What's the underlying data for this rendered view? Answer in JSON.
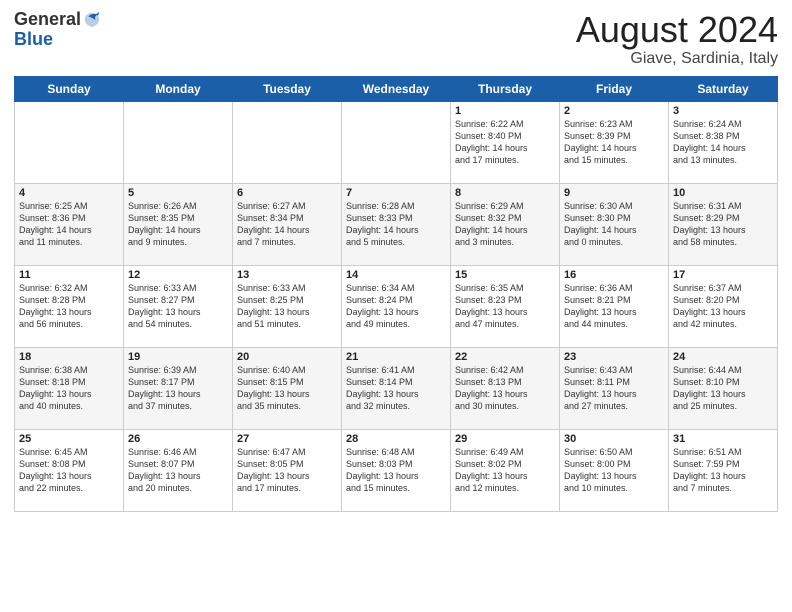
{
  "header": {
    "logo_line1": "General",
    "logo_line2": "Blue",
    "month_title": "August 2024",
    "location": "Giave, Sardinia, Italy"
  },
  "days_of_week": [
    "Sunday",
    "Monday",
    "Tuesday",
    "Wednesday",
    "Thursday",
    "Friday",
    "Saturday"
  ],
  "weeks": [
    [
      {
        "day": "",
        "info": ""
      },
      {
        "day": "",
        "info": ""
      },
      {
        "day": "",
        "info": ""
      },
      {
        "day": "",
        "info": ""
      },
      {
        "day": "1",
        "info": "Sunrise: 6:22 AM\nSunset: 8:40 PM\nDaylight: 14 hours\nand 17 minutes."
      },
      {
        "day": "2",
        "info": "Sunrise: 6:23 AM\nSunset: 8:39 PM\nDaylight: 14 hours\nand 15 minutes."
      },
      {
        "day": "3",
        "info": "Sunrise: 6:24 AM\nSunset: 8:38 PM\nDaylight: 14 hours\nand 13 minutes."
      }
    ],
    [
      {
        "day": "4",
        "info": "Sunrise: 6:25 AM\nSunset: 8:36 PM\nDaylight: 14 hours\nand 11 minutes."
      },
      {
        "day": "5",
        "info": "Sunrise: 6:26 AM\nSunset: 8:35 PM\nDaylight: 14 hours\nand 9 minutes."
      },
      {
        "day": "6",
        "info": "Sunrise: 6:27 AM\nSunset: 8:34 PM\nDaylight: 14 hours\nand 7 minutes."
      },
      {
        "day": "7",
        "info": "Sunrise: 6:28 AM\nSunset: 8:33 PM\nDaylight: 14 hours\nand 5 minutes."
      },
      {
        "day": "8",
        "info": "Sunrise: 6:29 AM\nSunset: 8:32 PM\nDaylight: 14 hours\nand 3 minutes."
      },
      {
        "day": "9",
        "info": "Sunrise: 6:30 AM\nSunset: 8:30 PM\nDaylight: 14 hours\nand 0 minutes."
      },
      {
        "day": "10",
        "info": "Sunrise: 6:31 AM\nSunset: 8:29 PM\nDaylight: 13 hours\nand 58 minutes."
      }
    ],
    [
      {
        "day": "11",
        "info": "Sunrise: 6:32 AM\nSunset: 8:28 PM\nDaylight: 13 hours\nand 56 minutes."
      },
      {
        "day": "12",
        "info": "Sunrise: 6:33 AM\nSunset: 8:27 PM\nDaylight: 13 hours\nand 54 minutes."
      },
      {
        "day": "13",
        "info": "Sunrise: 6:33 AM\nSunset: 8:25 PM\nDaylight: 13 hours\nand 51 minutes."
      },
      {
        "day": "14",
        "info": "Sunrise: 6:34 AM\nSunset: 8:24 PM\nDaylight: 13 hours\nand 49 minutes."
      },
      {
        "day": "15",
        "info": "Sunrise: 6:35 AM\nSunset: 8:23 PM\nDaylight: 13 hours\nand 47 minutes."
      },
      {
        "day": "16",
        "info": "Sunrise: 6:36 AM\nSunset: 8:21 PM\nDaylight: 13 hours\nand 44 minutes."
      },
      {
        "day": "17",
        "info": "Sunrise: 6:37 AM\nSunset: 8:20 PM\nDaylight: 13 hours\nand 42 minutes."
      }
    ],
    [
      {
        "day": "18",
        "info": "Sunrise: 6:38 AM\nSunset: 8:18 PM\nDaylight: 13 hours\nand 40 minutes."
      },
      {
        "day": "19",
        "info": "Sunrise: 6:39 AM\nSunset: 8:17 PM\nDaylight: 13 hours\nand 37 minutes."
      },
      {
        "day": "20",
        "info": "Sunrise: 6:40 AM\nSunset: 8:15 PM\nDaylight: 13 hours\nand 35 minutes."
      },
      {
        "day": "21",
        "info": "Sunrise: 6:41 AM\nSunset: 8:14 PM\nDaylight: 13 hours\nand 32 minutes."
      },
      {
        "day": "22",
        "info": "Sunrise: 6:42 AM\nSunset: 8:13 PM\nDaylight: 13 hours\nand 30 minutes."
      },
      {
        "day": "23",
        "info": "Sunrise: 6:43 AM\nSunset: 8:11 PM\nDaylight: 13 hours\nand 27 minutes."
      },
      {
        "day": "24",
        "info": "Sunrise: 6:44 AM\nSunset: 8:10 PM\nDaylight: 13 hours\nand 25 minutes."
      }
    ],
    [
      {
        "day": "25",
        "info": "Sunrise: 6:45 AM\nSunset: 8:08 PM\nDaylight: 13 hours\nand 22 minutes."
      },
      {
        "day": "26",
        "info": "Sunrise: 6:46 AM\nSunset: 8:07 PM\nDaylight: 13 hours\nand 20 minutes."
      },
      {
        "day": "27",
        "info": "Sunrise: 6:47 AM\nSunset: 8:05 PM\nDaylight: 13 hours\nand 17 minutes."
      },
      {
        "day": "28",
        "info": "Sunrise: 6:48 AM\nSunset: 8:03 PM\nDaylight: 13 hours\nand 15 minutes."
      },
      {
        "day": "29",
        "info": "Sunrise: 6:49 AM\nSunset: 8:02 PM\nDaylight: 13 hours\nand 12 minutes."
      },
      {
        "day": "30",
        "info": "Sunrise: 6:50 AM\nSunset: 8:00 PM\nDaylight: 13 hours\nand 10 minutes."
      },
      {
        "day": "31",
        "info": "Sunrise: 6:51 AM\nSunset: 7:59 PM\nDaylight: 13 hours\nand 7 minutes."
      }
    ]
  ],
  "alt_row_indices": [
    1,
    3
  ]
}
